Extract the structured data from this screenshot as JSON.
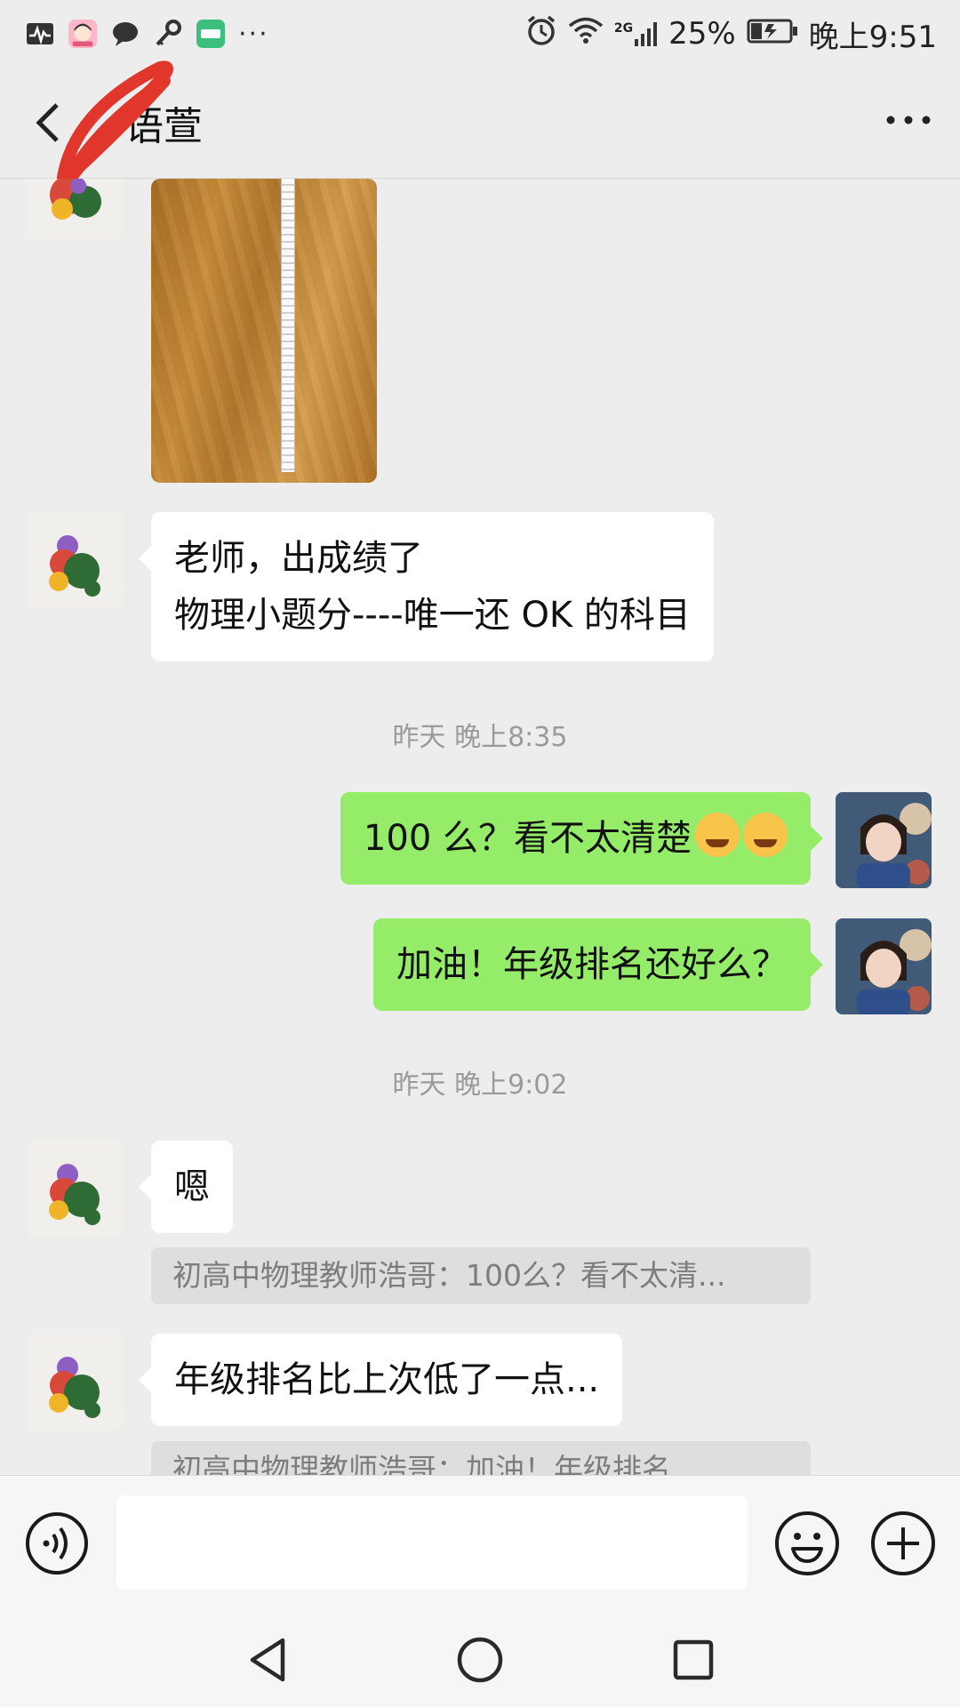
{
  "status_bar": {
    "left_icons": [
      "activity-monitor-icon",
      "girl-app-icon",
      "message-bubble-icon",
      "key-icon",
      "app-badge-icon"
    ],
    "overflow": "···",
    "network": "2G",
    "battery": "25%",
    "time": "晚上9:51"
  },
  "header": {
    "title": "语萱",
    "back_icon": "chevron-left-icon",
    "more_icon": "more-dots-icon"
  },
  "chat": {
    "messages": [
      {
        "side": "left",
        "type": "image",
        "description": "photo"
      },
      {
        "side": "left",
        "type": "text",
        "lines": [
          "老师，出成绩了",
          "物理小题分----唯一还 OK 的科目"
        ]
      },
      {
        "side": "center",
        "type": "timestamp",
        "text": "昨天 晚上8:35"
      },
      {
        "side": "right",
        "type": "text",
        "text": "100 么？看不太清楚"
      },
      {
        "side": "right",
        "type": "text",
        "text": "加油！年级排名还好么？"
      },
      {
        "side": "center",
        "type": "timestamp",
        "text": "昨天 晚上9:02"
      },
      {
        "side": "left",
        "type": "text",
        "text": "嗯",
        "quote": "初高中物理教师浩哥：100么？看不太清..."
      },
      {
        "side": "left",
        "type": "text",
        "text": "年级排名比上次低了一点...",
        "quote": "初高中物理教师浩哥：加油！年级排名..."
      }
    ]
  },
  "input_bar": {
    "voice_icon": "voice-icon",
    "emoji_icon": "emoji-smile-icon",
    "plus_icon": "plus-icon",
    "placeholder": ""
  },
  "nav_bar": {
    "back_icon": "nav-back-icon",
    "home_icon": "nav-home-icon",
    "recents_icon": "nav-recents-icon"
  },
  "colors": {
    "background": "#ededed",
    "bubble_self": "#95ec69",
    "bubble_other": "#ffffff",
    "timestamp": "#9a9a9a"
  }
}
